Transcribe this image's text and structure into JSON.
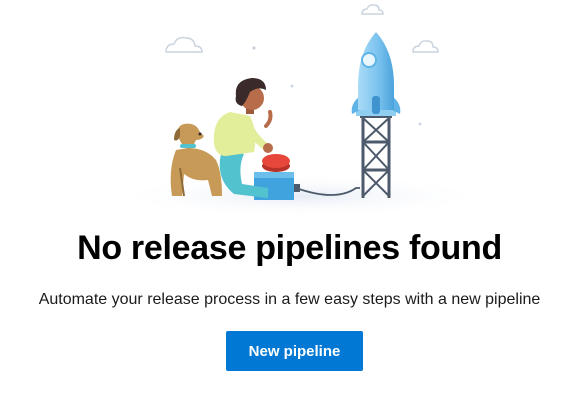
{
  "empty_state": {
    "title": "No release pipelines found",
    "description": "Automate your release process in a few easy steps with a new pipeline",
    "new_pipeline_label": "New pipeline"
  },
  "colors": {
    "accent": "#0078d4",
    "rocket": "#7fc4ef",
    "tower": "#4d5a6b",
    "box": "#40a3dd",
    "button_red": "#e6473a",
    "dog": "#c79a58",
    "person_top": "#e3ee9b",
    "person_pants": "#52c3ce"
  },
  "icons": [
    "cloud-icon",
    "rocket-icon",
    "dog-icon",
    "person-icon",
    "launch-button-icon"
  ]
}
